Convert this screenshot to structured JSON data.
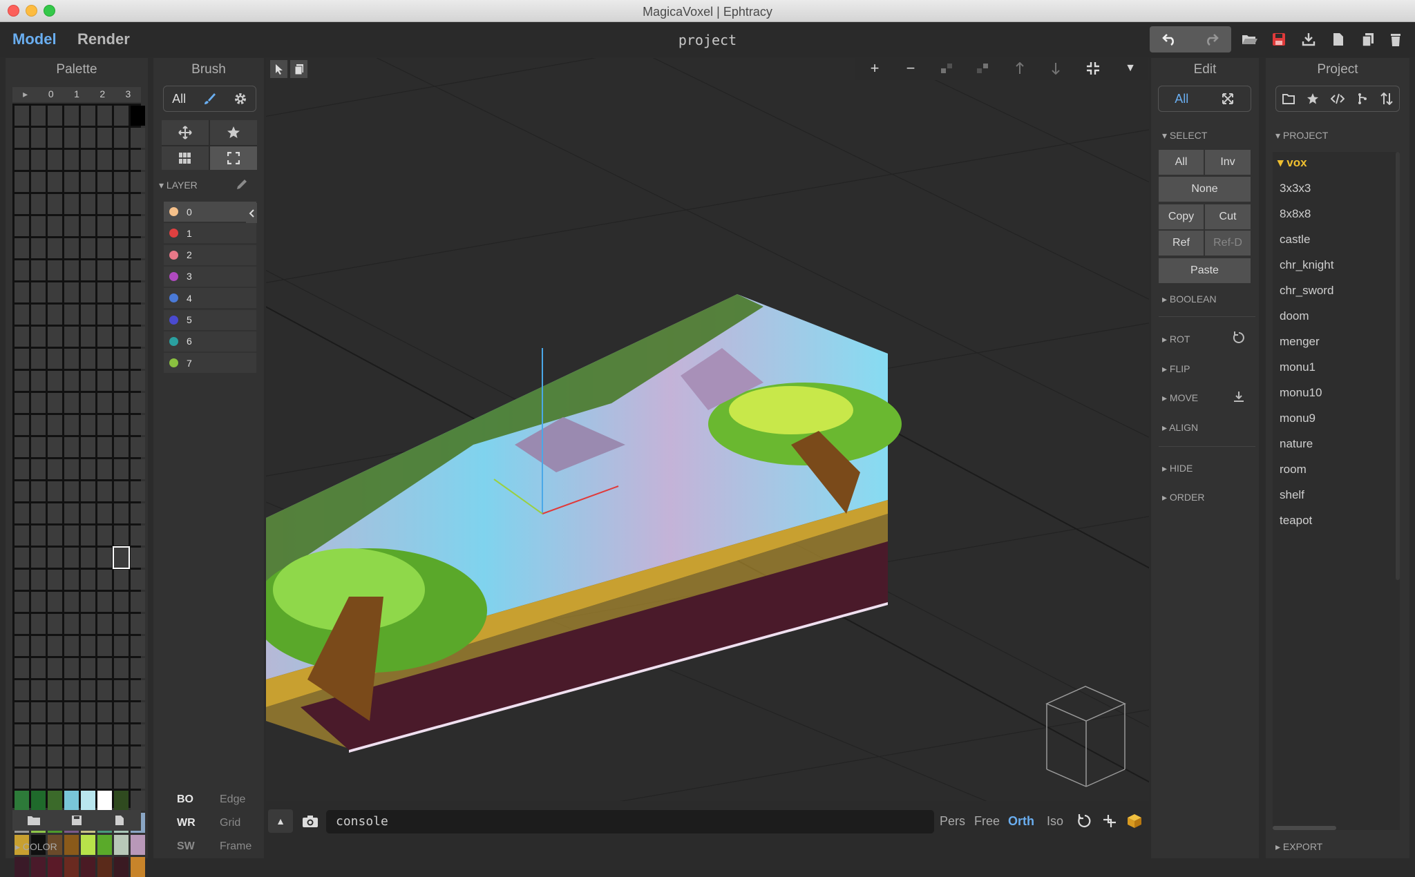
{
  "window": {
    "title": "MagicaVoxel | Ephtracy"
  },
  "menu": {
    "model": "Model",
    "render": "Render",
    "project_name": "project"
  },
  "toolbar_icons": [
    "undo-icon",
    "redo-icon",
    "open-icon",
    "save-icon",
    "export-icon",
    "new-file-icon",
    "copy-file-icon",
    "delete-icon"
  ],
  "palette": {
    "title": "Palette",
    "tabs": [
      "▸",
      "0",
      "1",
      "2",
      "3"
    ],
    "section": "COLOR",
    "colors": {
      "row_a": [
        "#2d7a39",
        "#1f6a2b",
        "#3b6a2a",
        "#79c6d8",
        "#b9e6ee",
        "#ffffff",
        "#2f4a1f",
        "#3b3b3b"
      ],
      "row_b": [
        "#9a9a9a",
        "#8fc64a",
        "#4d9a2b",
        "#7a5a8a",
        "#c8c486",
        "#4a9a7a",
        "#a8c8b8",
        "#8aa6c4"
      ],
      "row_c": [
        "#c8a030",
        "#101010",
        "#6a4a2a",
        "#8a5a1a",
        "#b8e24a",
        "#5aaa2a",
        "#b8c8b8",
        "#b898b8"
      ],
      "row_d": [
        "#3a1a28",
        "#4a1a2a",
        "#5a1a28",
        "#6a2a20",
        "#4a1a24",
        "#5a2a1a",
        "#3a1a22",
        "#c8842a"
      ]
    }
  },
  "brush": {
    "title": "Brush",
    "mode": "All",
    "layer_section": "LAYER",
    "layers": [
      {
        "label": "0",
        "color": "#f5c08a"
      },
      {
        "label": "1",
        "color": "#e04040"
      },
      {
        "label": "2",
        "color": "#e87888"
      },
      {
        "label": "3",
        "color": "#b04ac0"
      },
      {
        "label": "4",
        "color": "#4a7ad8"
      },
      {
        "label": "5",
        "color": "#4a4ad0"
      },
      {
        "label": "6",
        "color": "#2aa0a0"
      },
      {
        "label": "7",
        "color": "#8ac040"
      }
    ],
    "bottom": [
      {
        "a": "BO",
        "b": "Edge"
      },
      {
        "a": "WR",
        "b": "Grid"
      },
      {
        "a": "SW",
        "b": "Frame"
      }
    ]
  },
  "viewport": {
    "console": "console",
    "views": [
      "Pers",
      "Free",
      "Orth",
      "Iso"
    ],
    "active_view": "Orth"
  },
  "edit": {
    "title": "Edit",
    "mode": "All",
    "select": "SELECT",
    "all": "All",
    "inv": "Inv",
    "none": "None",
    "copy": "Copy",
    "cut": "Cut",
    "ref": "Ref",
    "refd": "Ref-D",
    "paste": "Paste",
    "boolean": "BOOLEAN",
    "rot": "ROT",
    "flip": "FLIP",
    "move": "MOVE",
    "align": "ALIGN",
    "hide": "HIDE",
    "order": "ORDER"
  },
  "project": {
    "title": "Project",
    "section": "PROJECT",
    "folder": "vox",
    "items": [
      "3x3x3",
      "8x8x8",
      "castle",
      "chr_knight",
      "chr_sword",
      "doom",
      "menger",
      "monu1",
      "monu10",
      "monu9",
      "nature",
      "room",
      "shelf",
      "teapot"
    ],
    "export": "EXPORT"
  }
}
